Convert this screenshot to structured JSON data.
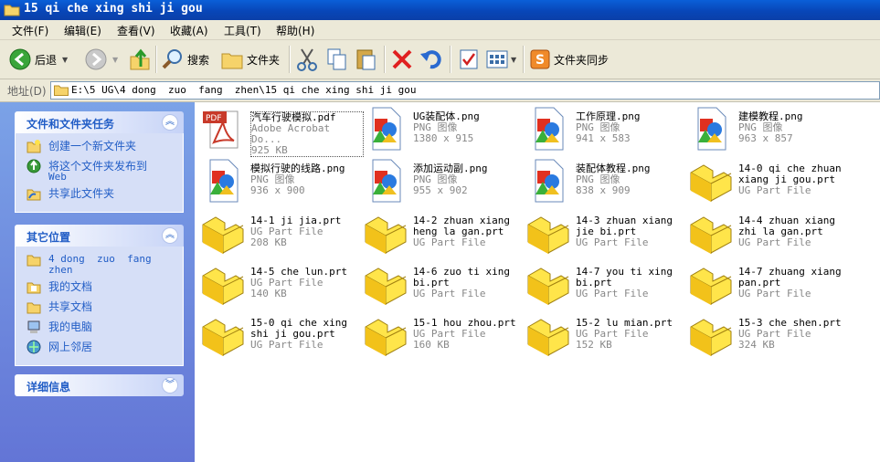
{
  "window": {
    "title": "15 qi che xing shi ji gou"
  },
  "menu": [
    "文件(F)",
    "编辑(E)",
    "查看(V)",
    "收藏(A)",
    "工具(T)",
    "帮助(H)"
  ],
  "toolbar": {
    "back": "后退",
    "search": "搜索",
    "folders": "文件夹",
    "sync": "文件夹同步"
  },
  "address": {
    "label": "地址(D)",
    "path": "E:\\5 UG\\4 dong  zuo  fang  zhen\\15 qi che xing shi ji gou"
  },
  "tasks": {
    "title": "文件和文件夹任务",
    "items": [
      "创建一个新文件夹",
      "将这个文件夹发布到",
      "Web",
      "共享此文件夹"
    ]
  },
  "other": {
    "title": "其它位置",
    "items": [
      "4 dong  zuo  fang",
      "zhen",
      "我的文档",
      "共享文档",
      "我的电脑",
      "网上邻居"
    ]
  },
  "details": {
    "title": "详细信息"
  },
  "files": [
    {
      "name": "汽车行驶模拟.pdf",
      "type": "Adobe Acrobat Do...",
      "meta": "925 KB",
      "icon": "pdf-icon"
    },
    {
      "name": "UG装配体.png",
      "type": "PNG 图像",
      "meta": "1380 x 915",
      "icon": "png-icon"
    },
    {
      "name": "工作原理.png",
      "type": "PNG 图像",
      "meta": "941 x 583",
      "icon": "png-icon"
    },
    {
      "name": "建模教程.png",
      "type": "PNG 图像",
      "meta": "963 x 857",
      "icon": "png-icon"
    },
    {
      "name": "模拟行驶的线路.png",
      "type": "PNG 图像",
      "meta": "936 x 900",
      "icon": "png-icon"
    },
    {
      "name": "添加运动副.png",
      "type": "PNG 图像",
      "meta": "955 x 902",
      "icon": "png-icon"
    },
    {
      "name": "装配体教程.png",
      "type": "PNG 图像",
      "meta": "838 x 909",
      "icon": "png-icon"
    },
    {
      "name": "14-0  qi che zhuan xiang ji gou.prt",
      "type": "UG Part File",
      "meta": "",
      "icon": "ug-part-icon"
    },
    {
      "name": "14-1 ji jia.prt",
      "type": "UG Part File",
      "meta": "208 KB",
      "icon": "ug-part-icon"
    },
    {
      "name": "14-2 zhuan xiang heng la gan.prt",
      "type": "UG Part File",
      "meta": "",
      "icon": "ug-part-icon"
    },
    {
      "name": "14-3 zhuan xiang jie bi.prt",
      "type": "UG Part File",
      "meta": "",
      "icon": "ug-part-icon"
    },
    {
      "name": "14-4 zhuan xiang zhi la gan.prt",
      "type": "UG Part File",
      "meta": "",
      "icon": "ug-part-icon"
    },
    {
      "name": "14-5 che lun.prt",
      "type": "UG Part File",
      "meta": "140 KB",
      "icon": "ug-part-icon"
    },
    {
      "name": "14-6 zuo ti xing bi.prt",
      "type": "UG Part File",
      "meta": "",
      "icon": "ug-part-icon"
    },
    {
      "name": "14-7 you ti xing bi.prt",
      "type": "UG Part File",
      "meta": "",
      "icon": "ug-part-icon"
    },
    {
      "name": "14-7 zhuang xiang pan.prt",
      "type": "UG Part File",
      "meta": "",
      "icon": "ug-part-icon"
    },
    {
      "name": "15-0 qi che xing shi ji gou.prt",
      "type": "UG Part File",
      "meta": "",
      "icon": "ug-part-icon"
    },
    {
      "name": "15-1 hou zhou.prt",
      "type": "UG Part File",
      "meta": "160 KB",
      "icon": "ug-part-icon"
    },
    {
      "name": "15-2 lu mian.prt",
      "type": "UG Part File",
      "meta": "152 KB",
      "icon": "ug-part-icon"
    },
    {
      "name": "15-3 che shen.prt",
      "type": "UG Part File",
      "meta": "324 KB",
      "icon": "ug-part-icon"
    }
  ]
}
